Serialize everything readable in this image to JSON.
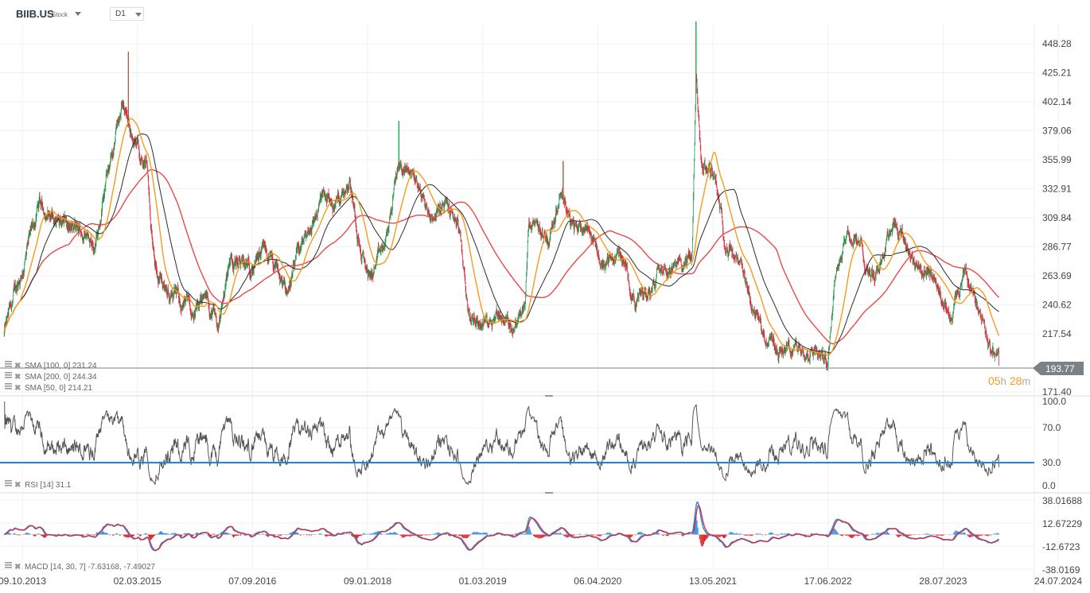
{
  "header": {
    "symbol": "BIIB.US",
    "type": "Stock",
    "timeframe": "D1"
  },
  "current_price": "193.77",
  "countdown": {
    "hours": "05",
    "h": "h",
    "minutes": "28",
    "m": "m"
  },
  "legends": {
    "sma100": "SMA [100, 0] 231.24",
    "sma200": "SMA [200, 0] 244.34",
    "sma50": "SMA [50, 0] 214.21",
    "rsi": "RSI [14] 31.1",
    "macd": "MACD [14, 30, 7] -7.63168, -7.49027"
  },
  "colors": {
    "up": "#1e9a4e",
    "down": "#e0283a",
    "sma50": "#f39c1f",
    "sma100": "#2b2b2b",
    "sma200": "#e84a4a",
    "rsi": "#555555",
    "rsi_level": "#1a87e6",
    "macd": "#3b8fd8",
    "signal": "#d9262f"
  },
  "chart_data": {
    "type": "candlestick",
    "price_ticks": [
      "448.28",
      "425.21",
      "402.14",
      "379.06",
      "355.99",
      "332.91",
      "309.84",
      "286.77",
      "263.69",
      "240.62",
      "217.54",
      "171.40"
    ],
    "price_range": [
      171.4,
      448.28
    ],
    "x_ticks": [
      "09.10.2013",
      "02.03.2015",
      "07.09.2016",
      "09.01.2018",
      "01.03.2019",
      "06.04.2020",
      "13.05.2021",
      "17.06.2022",
      "28.07.2023",
      "24.07.2024"
    ],
    "x_tick_years": [
      2013.77,
      2015.17,
      2016.68,
      2018.02,
      2019.16,
      2020.26,
      2021.36,
      2022.46,
      2023.57,
      2024.56
    ],
    "close_anchors": [
      [
        2013.55,
        217.6
      ],
      [
        2013.74,
        261.8
      ],
      [
        2013.98,
        318.7
      ],
      [
        2014.37,
        299.7
      ],
      [
        2014.66,
        293.4
      ],
      [
        2014.85,
        356.6
      ],
      [
        2015.0,
        400.9
      ],
      [
        2015.14,
        369.3
      ],
      [
        2015.3,
        350.3
      ],
      [
        2015.4,
        268.2
      ],
      [
        2015.61,
        249.2
      ],
      [
        2015.87,
        236.6
      ],
      [
        2016.08,
        242.9
      ],
      [
        2016.24,
        224.0
      ],
      [
        2016.39,
        280.8
      ],
      [
        2016.6,
        268.2
      ],
      [
        2016.84,
        280.8
      ],
      [
        2017.07,
        249.2
      ],
      [
        2017.26,
        287.1
      ],
      [
        2017.49,
        325.0
      ],
      [
        2017.63,
        318.7
      ],
      [
        2017.81,
        344.0
      ],
      [
        2017.95,
        280.8
      ],
      [
        2018.04,
        261.8
      ],
      [
        2018.2,
        287.1
      ],
      [
        2018.32,
        350.3
      ],
      [
        2018.48,
        344.0
      ],
      [
        2018.63,
        312.4
      ],
      [
        2018.79,
        318.7
      ],
      [
        2018.91,
        306.1
      ],
      [
        2019.03,
        230.2
      ],
      [
        2019.18,
        227.1
      ],
      [
        2019.3,
        236.6
      ],
      [
        2019.45,
        224.0
      ],
      [
        2019.56,
        236.6
      ],
      [
        2019.6,
        299.7
      ],
      [
        2019.79,
        293.4
      ],
      [
        2019.91,
        337.7
      ],
      [
        2020.02,
        299.7
      ],
      [
        2020.17,
        306.1
      ],
      [
        2020.29,
        274.5
      ],
      [
        2020.48,
        280.8
      ],
      [
        2020.63,
        242.9
      ],
      [
        2020.78,
        255.5
      ],
      [
        2020.86,
        280.8
      ],
      [
        2021.01,
        268.2
      ],
      [
        2021.16,
        280.8
      ],
      [
        2021.2,
        419.8
      ],
      [
        2021.25,
        350.3
      ],
      [
        2021.39,
        344.0
      ],
      [
        2021.46,
        299.7
      ],
      [
        2021.62,
        268.2
      ],
      [
        2021.69,
        242.9
      ],
      [
        2021.85,
        217.6
      ],
      [
        2022.0,
        205.0
      ],
      [
        2022.15,
        205.0
      ],
      [
        2022.3,
        211.3
      ],
      [
        2022.45,
        198.6
      ],
      [
        2022.53,
        268.2
      ],
      [
        2022.64,
        299.7
      ],
      [
        2022.76,
        287.1
      ],
      [
        2022.91,
        261.8
      ],
      [
        2023.1,
        312.4
      ],
      [
        2023.22,
        287.1
      ],
      [
        2023.37,
        268.2
      ],
      [
        2023.53,
        255.5
      ],
      [
        2023.64,
        230.2
      ],
      [
        2023.76,
        261.8
      ],
      [
        2023.87,
        242.9
      ],
      [
        2023.95,
        217.6
      ],
      [
        2024.05,
        193.77
      ]
    ],
    "spikes": [
      [
        2015.06,
        442.0
      ],
      [
        2018.33,
        387.0
      ],
      [
        2019.93,
        355.0
      ],
      [
        2021.2,
        466.0
      ]
    ],
    "rsi_ticks": [
      "100.0",
      "70.0",
      "30.0",
      "0.0"
    ],
    "rsi_level": 30,
    "macd_ticks": [
      "38.01688",
      "12.67229",
      "-12.6723",
      "-38.0169"
    ],
    "macd_range": [
      -38.0169,
      38.01688
    ],
    "sma_periods": [
      50,
      100,
      200
    ],
    "rsi_period": 14,
    "macd_params": [
      14,
      30,
      7
    ]
  }
}
